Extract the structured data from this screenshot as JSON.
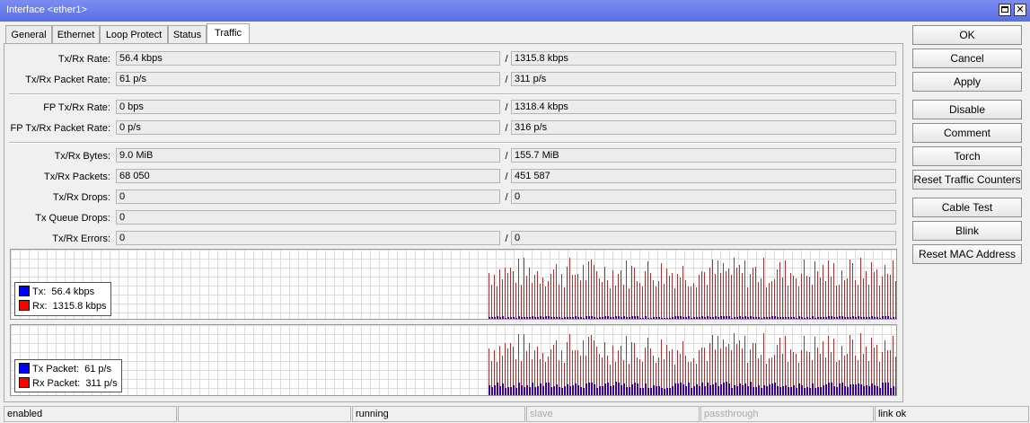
{
  "window": {
    "title": "Interface <ether1>"
  },
  "tabs": [
    {
      "label": "General"
    },
    {
      "label": "Ethernet"
    },
    {
      "label": "Loop Protect"
    },
    {
      "label": "Status"
    },
    {
      "label": "Traffic"
    }
  ],
  "active_tab": "Traffic",
  "fields": {
    "tx_rx_rate": {
      "label": "Tx/Rx Rate:",
      "tx": "56.4 kbps",
      "rx": "1315.8 kbps"
    },
    "tx_rx_packet_rate": {
      "label": "Tx/Rx Packet Rate:",
      "tx": "61 p/s",
      "rx": "311 p/s"
    },
    "fp_tx_rx_rate": {
      "label": "FP Tx/Rx Rate:",
      "tx": "0 bps",
      "rx": "1318.4 kbps"
    },
    "fp_tx_rx_packet_rate": {
      "label": "FP Tx/Rx Packet Rate:",
      "tx": "0 p/s",
      "rx": "316 p/s"
    },
    "tx_rx_bytes": {
      "label": "Tx/Rx Bytes:",
      "tx": "9.0 MiB",
      "rx": "155.7 MiB"
    },
    "tx_rx_packets": {
      "label": "Tx/Rx Packets:",
      "tx": "68 050",
      "rx": "451 587"
    },
    "tx_rx_drops": {
      "label": "Tx/Rx Drops:",
      "tx": "0",
      "rx": "0"
    },
    "tx_queue_drops": {
      "label": "Tx Queue Drops:",
      "value": "0"
    },
    "tx_rx_errors": {
      "label": "Tx/Rx Errors:",
      "tx": "0",
      "rx": "0"
    }
  },
  "separator": "/",
  "graphs": {
    "traffic": {
      "legend": [
        {
          "label": "Tx:",
          "value": "56.4 kbps",
          "color": "#0000ff"
        },
        {
          "label": "Rx:",
          "value": "1315.8 kbps",
          "color": "#ff0000"
        }
      ],
      "tx_color": "#3a00a0",
      "rx_color": "#b03030"
    },
    "packets": {
      "legend": [
        {
          "label": "Tx Packet:",
          "value": "61 p/s",
          "color": "#0000ff"
        },
        {
          "label": "Rx Packet:",
          "value": "311 p/s",
          "color": "#ff0000"
        }
      ],
      "tx_color": "#3a00a0",
      "rx_color": "#b03030"
    }
  },
  "buttons": [
    {
      "label": "OK"
    },
    {
      "label": "Cancel"
    },
    {
      "label": "Apply"
    },
    {
      "label": "Disable"
    },
    {
      "label": "Comment"
    },
    {
      "label": "Torch"
    },
    {
      "label": "Reset Traffic Counters"
    },
    {
      "label": "Cable Test"
    },
    {
      "label": "Blink"
    },
    {
      "label": "Reset MAC Address"
    }
  ],
  "status_bar": [
    {
      "text": "enabled",
      "enabled": true
    },
    {
      "text": "",
      "enabled": true
    },
    {
      "text": "running",
      "enabled": true
    },
    {
      "text": "slave",
      "enabled": false
    },
    {
      "text": "passthrough",
      "enabled": false
    },
    {
      "text": "link ok",
      "enabled": true
    }
  ]
}
